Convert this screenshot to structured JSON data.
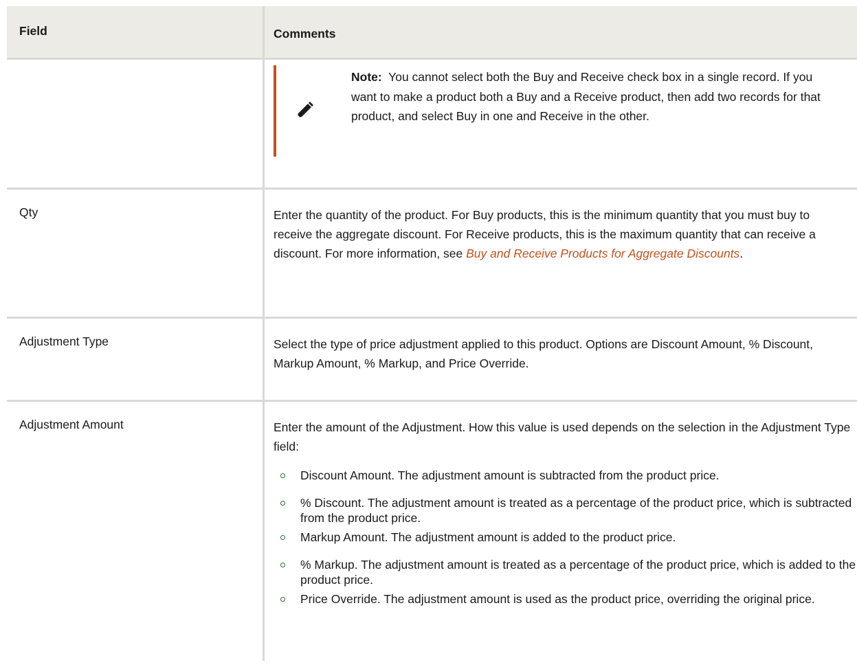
{
  "table": {
    "header": {
      "field": "Field",
      "comments": "Comments"
    },
    "note": {
      "label": "Note:",
      "text": "You cannot select both the Buy and Receive check box in a single record. If you want to make a product both a Buy and a Receive product, then add two records for that product, and select Buy in one and Receive in the other.",
      "icon": "pencil-icon"
    },
    "rows": [
      {
        "field": "Qty",
        "comment_before": "Enter the quantity of the product. For Buy products, this is the minimum quantity that you must buy to receive the aggregate discount. For Receive products, this is the maximum quantity that can receive a discount. For more information, see ",
        "link": "Buy and Receive Products for Aggregate Discounts",
        "comment_after": "."
      },
      {
        "field": "Adjustment Type",
        "comment": "Select the type of price adjustment applied to this product. Options are Discount Amount, % Discount, Markup Amount, % Markup, and Price Override."
      },
      {
        "field": "Adjustment Amount",
        "comment": "Enter the amount of the Adjustment. How this value is used depends on the selection in the Adjustment Type field:",
        "bullets": [
          "Discount Amount. The adjustment amount is subtracted from the product price.",
          "% Discount. The adjustment amount is treated as a percentage of the product price, which is subtracted from the product price.",
          "Markup Amount. The adjustment amount is added to the product price.",
          "% Markup. The adjustment amount is treated as a percentage of the product price, which is added to the product price.",
          "Price Override. The adjustment amount is used as the product price, overriding the original price."
        ]
      }
    ]
  },
  "colors": {
    "accent": "#c2521c",
    "header_bg": "#ecebe6",
    "border": "#d9d9d6",
    "bullet": "#2b6b2b"
  }
}
